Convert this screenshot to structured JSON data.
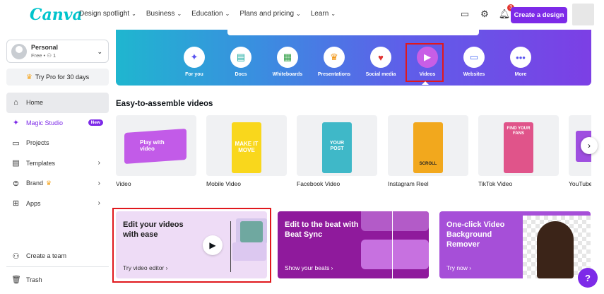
{
  "app": {
    "logo": "Canva"
  },
  "nav": [
    {
      "label": "Design spotlight"
    },
    {
      "label": "Business"
    },
    {
      "label": "Education"
    },
    {
      "label": "Plans and pricing"
    },
    {
      "label": "Learn"
    }
  ],
  "top": {
    "notification_count": "3",
    "create_label": "Create a design"
  },
  "account": {
    "name": "Personal",
    "sub": "Free • ⚇ 1"
  },
  "pro": {
    "label": "Try Pro for 30 days"
  },
  "sidebar": {
    "items": [
      {
        "label": "Home",
        "icon": "home-icon"
      },
      {
        "label": "Magic Studio",
        "icon": "sparkle-icon",
        "badge": "New"
      },
      {
        "label": "Projects",
        "icon": "folder-icon"
      },
      {
        "label": "Templates",
        "icon": "templates-icon"
      },
      {
        "label": "Brand",
        "icon": "brand-icon"
      },
      {
        "label": "Apps",
        "icon": "apps-icon"
      }
    ],
    "bottom": [
      {
        "label": "Create a team",
        "icon": "team-icon"
      },
      {
        "label": "Trash",
        "icon": "trash-icon"
      }
    ]
  },
  "categories": [
    {
      "label": "For you",
      "icon": "✦",
      "color": "#5b55f0"
    },
    {
      "label": "Docs",
      "icon": "▤",
      "color": "#13a89e"
    },
    {
      "label": "Whiteboards",
      "icon": "▦",
      "color": "#2f9e44"
    },
    {
      "label": "Presentations",
      "icon": "♛",
      "color": "#f08c00"
    },
    {
      "label": "Social media",
      "icon": "♥",
      "color": "#e03131"
    },
    {
      "label": "Videos",
      "icon": "▶",
      "color": "#ffffff"
    },
    {
      "label": "Websites",
      "icon": "▭",
      "color": "#4c6ef5"
    },
    {
      "label": "More",
      "icon": "•••",
      "color": "#5b55f0"
    }
  ],
  "section": {
    "title": "Easy-to-assemble videos"
  },
  "video_cards": [
    {
      "label": "Video",
      "thumb_text": "Play with video"
    },
    {
      "label": "Mobile Video",
      "thumb_text": "MAKE IT MOVE"
    },
    {
      "label": "Facebook Video",
      "thumb_text": "YOUR POST"
    },
    {
      "label": "Instagram Reel",
      "thumb_text": "SCROLL"
    },
    {
      "label": "TikTok Video",
      "thumb_text": "FIND YOUR FANS"
    },
    {
      "label": "YouTube",
      "thumb_text": ""
    }
  ],
  "tiles": [
    {
      "title": "Edit your videos with ease",
      "link": "Try video editor ›"
    },
    {
      "title": "Edit to the beat with Beat Sync",
      "link": "Show your beats ›"
    },
    {
      "title": "One-click Video Background Remover",
      "link": "Try now ›"
    }
  ],
  "help": {
    "label": "?"
  }
}
